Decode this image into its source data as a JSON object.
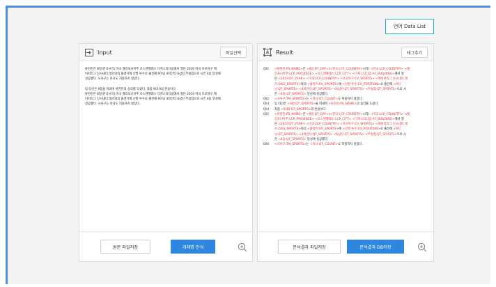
{
  "header": {
    "lang_list_label": "언어 Data List"
  },
  "input_panel": {
    "title": "Input",
    "file_select_label": "파일선택",
    "paragraphs": [
      [
        "류현진은 8일(한국시각) 미국 캘리포니아주 로스앤젤레스 다저스타디움에서 열린 2019 미국 프로야구 메",
        "이저리그 신시내티 레즈와의 홈경기에 선발 투수로 출전해 9이닝 4피안타 6삼진 무실점으로 시즌 4승 달성에",
        "성공했다. 시사구는 하나도 허용하지 않았다."
      ],
      [
        "팀 타선은 9점을 마내며 류현진의 승리를 도왔다. 최종 9대 0의 완승이다.",
        "류현진은 8일(한국시각) 미국 캘리포니아주 로스앤젤레스 다저스타디움에서 열린 2019 미국 프로야구 메",
        "이저리그 신시내티 레즈와의 홈경기에 선발 투수로 출전해 9이닝 4피안타 6삼진 무실점으로 시즌 4승 달성에",
        "성공했다. 시사구는 하나도 허용하지 않았다."
      ]
    ],
    "save_label": "원문 파일저장",
    "recognize_label": "개체명 인식"
  },
  "result_panel": {
    "title": "Result",
    "add_tag_label": "태그추가",
    "lines": [
      {
        "num": "001",
        "text": "<류현진:PS_NAME>은 <8일:DT_DAY>(<한국:LCP_COUNTRY>시각) <미국:LCP_COUNTRY> <캘"
      },
      {
        "num": "",
        "text": "리포니아주:LCP_PROVINCE> <로스앤젤레스:LCP_CITY> <다저스타디움:AF_BUILDING>에서 열"
      },
      {
        "num": "",
        "text": "린 <2019:DT_YEAR> <미국:LCP_COUNTRY> <프로야구:CV_SPORTS> <메이저리그 신시내티 레"
      },
      {
        "num": "",
        "text": "즈:OGG_SPORTS>와의 <홈경기:EV_SPORTS>에 <선발 투수:CV_POSITION>로 출전해 <9이"
      },
      {
        "num": "",
        "text": "닝:QT_SPORTS> <4피안타:QT_SPORTS> <6삼진:QT_SPORTS> <무실점:QT_SPORTS>으로 시"
      },
      {
        "num": "",
        "text": "즌 <4승:QT_SPORTS> 달성에 성공했다."
      },
      {
        "num": "002",
        "text": "<사사구:TM_SPORTS>는 <하나:QT_COUNT>도 허용하지 않았다."
      },
      {
        "num": "003",
        "text": "팀 타선은 <9점:QT_SPORTS>을 마내며 <류현진:PS_NAME>의 승리를 도왔다."
      },
      {
        "num": "004",
        "text": "최종 <9대0:QT_SPORTS>의 완승이다."
      },
      {
        "num": "005",
        "text": "<류현진:PS_NAME>은 <8일:DT_DAY>(<한국:LCP_COUNTRY>시각) <미국:LCP_COUNTRY> <캘"
      },
      {
        "num": "",
        "text": "리포니아주:LCP_PROVINCE> <로스앤젤레스:LCP_CITY> <다저스타디움:AF_BUILDING>에서 열"
      },
      {
        "num": "",
        "text": "린 <2019:DT_YEAR> <미국:LCP_COUNTRY> <프로야구:CV_SPORTS> <메이저리그 신시내티 레"
      },
      {
        "num": "",
        "text": "즈:OGG_SPORTS>와의 <홈경기:EV_SPORTS>에 <선발 투수:CV_POSITION>로 출전해 <9이"
      },
      {
        "num": "",
        "text": "닝:QT_SPORTS> <4피안타:QT_SPORTS> <6삼진:QT_SPORTS> <무실점:QT_SPORTS>으로 시"
      },
      {
        "num": "",
        "text": "즌 <4승:QT_SPORTS> 달성에 성공했다."
      },
      {
        "num": "006",
        "text": "<사사구:TM_SPORTS>는 <하나:QT_COUNT>도 허용하지 않았다."
      }
    ],
    "save_label": "분석결과 파일저장",
    "save_db_label": "분석결과 DB저장"
  },
  "colors": {
    "accent": "#2f86de",
    "frame": "#4a8fe1",
    "tag": "#e0302b",
    "teal": "#2ab6c1"
  },
  "icons": [
    "input-icon",
    "result-icon",
    "zoom-in-icon"
  ]
}
